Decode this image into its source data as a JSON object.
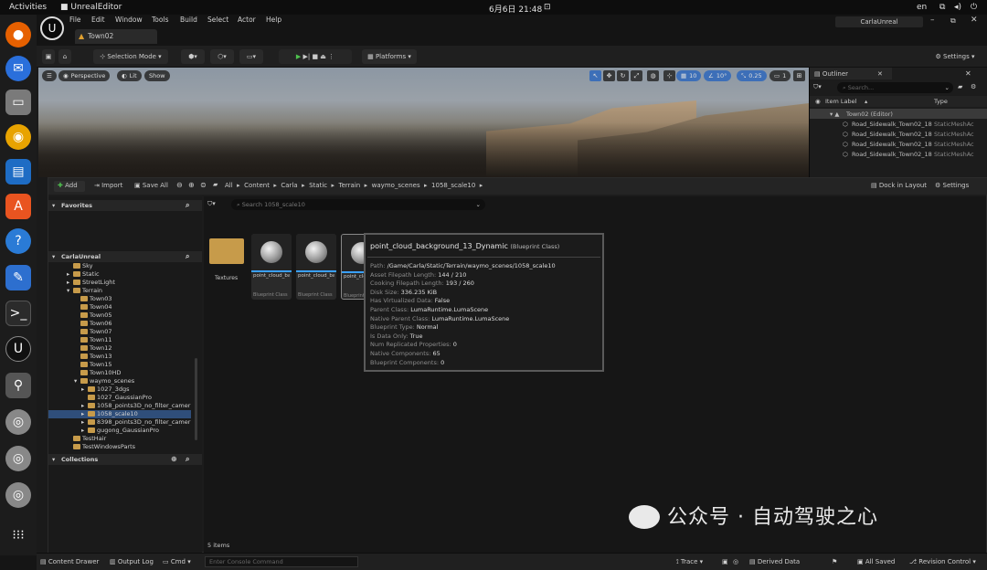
{
  "system": {
    "activities": "Activities",
    "app_name": "UnrealEditor",
    "clock": "6月6日 21:48",
    "lang": "en"
  },
  "dock": {
    "icons": [
      "firefox-icon",
      "thunderbird-icon",
      "files-icon",
      "rhythmbox-icon",
      "writer-icon",
      "software-icon",
      "help-icon",
      "text-editor-icon",
      "terminal-icon",
      "unreal-icon",
      "usb-icon",
      "disc-icon",
      "disc-icon",
      "disc-icon",
      "apps-grid-icon"
    ]
  },
  "editor": {
    "menu": [
      "File",
      "Edit",
      "Window",
      "Tools",
      "Build",
      "Select",
      "Actor",
      "Help"
    ],
    "project_name": "CarlaUnreal",
    "level_tab": "Town02",
    "toolbar": {
      "selection_mode": "Selection Mode",
      "platforms": "Platforms",
      "settings": "Settings"
    },
    "viewport": {
      "perspective": "Perspective",
      "lit": "Lit",
      "show": "Show",
      "grid_snap": "10",
      "rot_snap": "10°",
      "scale_snap": "0.25",
      "cam_speed": "1"
    },
    "outliner": {
      "title": "Outliner",
      "search_placeholder": "Search...",
      "col_label": "Item Label",
      "col_type": "Type",
      "rows": [
        {
          "label": "Town02 (Editor)",
          "type": ""
        },
        {
          "label": "Road_Sidewalk_Town02_18",
          "type": "StaticMeshAc"
        },
        {
          "label": "Road_Sidewalk_Town02_18",
          "type": "StaticMeshAc"
        },
        {
          "label": "Road_Sidewalk_Town02_18",
          "type": "StaticMeshAc"
        },
        {
          "label": "Road_Sidewalk_Town02_18",
          "type": "StaticMeshAc"
        }
      ]
    },
    "content_browser": {
      "add": "Add",
      "import": "Import",
      "save_all": "Save All",
      "path": [
        "All",
        "Content",
        "Carla",
        "Static",
        "Terrain",
        "waymo_scenes",
        "1058_scale10"
      ],
      "dock_in_layout": "Dock in Layout",
      "settings": "Settings",
      "favorites": "Favorites",
      "root": "CarlaUnreal",
      "collections": "Collections",
      "search_placeholder": "Search 1058_scale10",
      "tree": [
        {
          "label": "Sky",
          "depth": 2,
          "arrow": ""
        },
        {
          "label": "Static",
          "depth": 2,
          "arrow": "▸"
        },
        {
          "label": "StreetLight",
          "depth": 2,
          "arrow": "▸"
        },
        {
          "label": "Terrain",
          "depth": 2,
          "arrow": "▾"
        },
        {
          "label": "Town03",
          "depth": 3,
          "arrow": ""
        },
        {
          "label": "Town04",
          "depth": 3,
          "arrow": ""
        },
        {
          "label": "Town05",
          "depth": 3,
          "arrow": ""
        },
        {
          "label": "Town06",
          "depth": 3,
          "arrow": ""
        },
        {
          "label": "Town07",
          "depth": 3,
          "arrow": ""
        },
        {
          "label": "Town11",
          "depth": 3,
          "arrow": ""
        },
        {
          "label": "Town12",
          "depth": 3,
          "arrow": ""
        },
        {
          "label": "Town13",
          "depth": 3,
          "arrow": ""
        },
        {
          "label": "Town15",
          "depth": 3,
          "arrow": ""
        },
        {
          "label": "Town10HD",
          "depth": 3,
          "arrow": ""
        },
        {
          "label": "waymo_scenes",
          "depth": 3,
          "arrow": "▾"
        },
        {
          "label": "1027_3dgs",
          "depth": 4,
          "arrow": "▸"
        },
        {
          "label": "1027_GaussianPro",
          "depth": 4,
          "arrow": ""
        },
        {
          "label": "1058_points3D_no_filter_camer",
          "depth": 4,
          "arrow": "▸"
        },
        {
          "label": "1058_scale10",
          "depth": 4,
          "arrow": "▸",
          "selected": true
        },
        {
          "label": "8398_points3D_no_filter_camer",
          "depth": 4,
          "arrow": "▸"
        },
        {
          "label": "gugong_GaussianPro",
          "depth": 4,
          "arrow": "▸"
        },
        {
          "label": "TestHair",
          "depth": 2,
          "arrow": ""
        },
        {
          "label": "TestWindowsParts",
          "depth": 2,
          "arrow": ""
        }
      ],
      "folder_label": "Textures",
      "assets": [
        {
          "name": "point_cloud_background_...",
          "class": "Blueprint Class"
        },
        {
          "name": "point_cloud_background_...",
          "class": "Blueprint Class"
        },
        {
          "name": "point_cloud_backgrou...",
          "class": "Blueprint"
        },
        {
          "name": "",
          "class": ""
        }
      ],
      "item_count": "5 items"
    },
    "tooltip": {
      "title": "point_cloud_background_13_Dynamic",
      "subtitle": "(Blueprint Class)",
      "rows": [
        {
          "k": "Path:",
          "v": "/Game/Carla/Static/Terrain/waymo_scenes/1058_scale10"
        },
        {
          "k": "Asset Filepath Length:",
          "v": "144 / 210"
        },
        {
          "k": "Cooking Filepath Length:",
          "v": "193 / 260"
        },
        {
          "k": "Disk Size:",
          "v": "336.235 KiB"
        },
        {
          "k": "Has Virtualized Data:",
          "v": "False"
        },
        {
          "k": "Parent Class:",
          "v": "LumaRuntime.LumaScene"
        },
        {
          "k": "Native Parent Class:",
          "v": "LumaRuntime.LumaScene"
        },
        {
          "k": "Blueprint Type:",
          "v": "Normal"
        },
        {
          "k": "Is Data Only:",
          "v": "True"
        },
        {
          "k": "Num Replicated Properties:",
          "v": "0"
        },
        {
          "k": "Native Components:",
          "v": "65"
        },
        {
          "k": "Blueprint Components:",
          "v": "0"
        }
      ]
    },
    "statusbar": {
      "content_drawer": "Content Drawer",
      "output_log": "Output Log",
      "cmd": "Cmd",
      "console_placeholder": "Enter Console Command",
      "trace": "Trace",
      "derived_data": "Derived Data",
      "all_saved": "All Saved",
      "revision_control": "Revision Control"
    }
  },
  "watermark": "公众号 · 自动驾驶之心"
}
